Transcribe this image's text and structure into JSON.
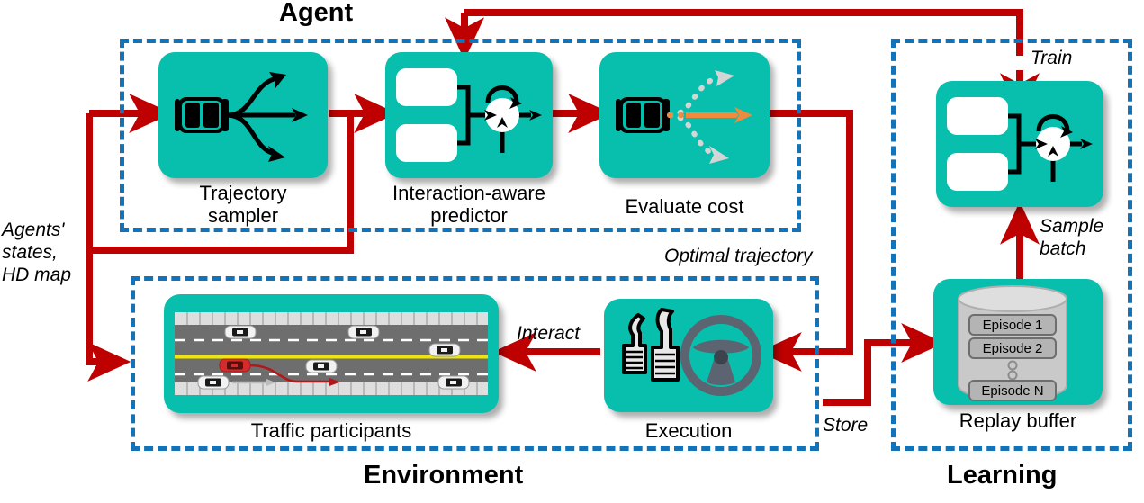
{
  "groups": [
    {
      "id": "agent",
      "title": "Agent"
    },
    {
      "id": "environment",
      "title": "Environment"
    },
    {
      "id": "learning",
      "title": "Learning"
    }
  ],
  "nodes": {
    "trajectory_sampler": {
      "label_line1": "Trajectory",
      "label_line2": "sampler",
      "icon": "car-fanout-trajectories-icon"
    },
    "interaction_predictor": {
      "label_line1": "Interaction-aware",
      "label_line2": "predictor",
      "icon": "recurrent-network-icon"
    },
    "evaluate_cost": {
      "label_line1": "Evaluate cost",
      "label_line2": "",
      "icon": "car-cost-trajectories-icon"
    },
    "traffic_participants": {
      "label_line1": "Traffic participants",
      "label_line2": "",
      "icon": "highway-traffic-scene-icon"
    },
    "execution": {
      "label_line1": "Execution",
      "label_line2": "",
      "icon": "pedals-steering-wheel-icon"
    },
    "replay_buffer": {
      "label_line1": "Replay buffer",
      "label_line2": "",
      "icon": "database-cylinder-icon"
    },
    "learning_network": {
      "label_line1": "",
      "label_line2": "",
      "icon": "recurrent-network-icon"
    }
  },
  "replay_buffer_items": [
    "Episode 1",
    "Episode 2",
    "Episode N"
  ],
  "edge_labels": {
    "agents_states": "Agents'\nstates,\nHD map",
    "agents_states_l1": "Agents'",
    "agents_states_l2": "states,",
    "agents_states_l3": "HD map",
    "optimal_trajectory": "Optimal trajectory",
    "interact": "Interact",
    "store": "Store",
    "train": "Train",
    "sample_batch_l1": "Sample",
    "sample_batch_l2": "batch"
  },
  "colors": {
    "teal_card": "#07BFAC",
    "dashed_group": "#1273B8",
    "flow_arrow_red": "#BE0000",
    "selected_trajectory_orange": "#F08A3C",
    "candidate_trajectory_gray": "#D5D5D5",
    "road_asphalt": "#6E6E6E",
    "lane_center_yellow": "#F2E600",
    "ego_car_red": "#D42C2C",
    "background": "#FFFFFF",
    "text": "#000000"
  }
}
